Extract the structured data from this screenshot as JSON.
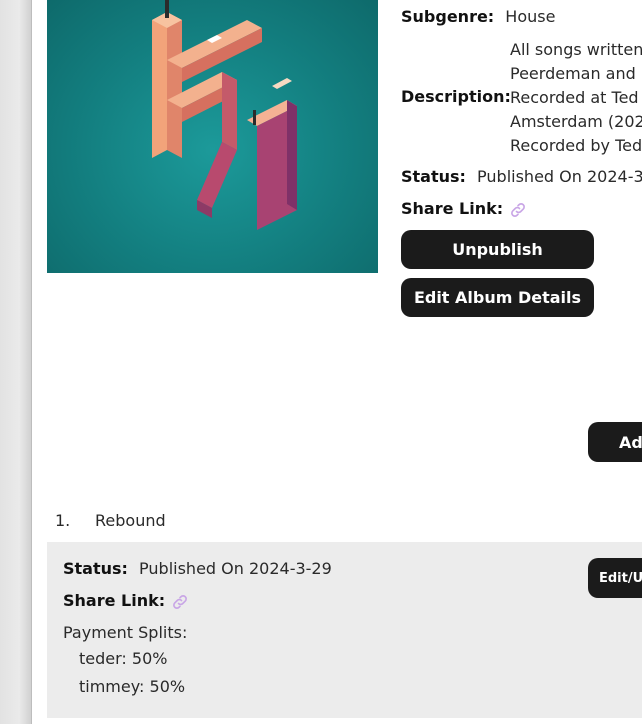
{
  "album": {
    "subgenre_label": "Subgenre:",
    "subgenre": "House",
    "description_label": "Description:",
    "description_lines": [
      "All songs written",
      "Peerdeman and",
      "Recorded at Ted",
      "Amsterdam (202",
      "Recorded by Ted"
    ],
    "status_label": "Status:",
    "status": "Published On 2024-3-",
    "share_link_label": "Share Link:",
    "unpublish_label": "Unpublish",
    "edit_details_label": "Edit Album Details",
    "add_button_label": "Ad"
  },
  "tracks": [
    {
      "number": "1.",
      "title": "Rebound",
      "status_label": "Status:",
      "status": "Published On 2024-3-29",
      "share_link_label": "Share Link:",
      "payment_splits_label": "Payment Splits:",
      "splits": [
        "teder: 50%",
        "timmey: 50%"
      ],
      "edit_button_label": "Edit/U"
    }
  ],
  "colors": {
    "button_bg": "#1b1b1b",
    "link_icon": "#c9a6e6",
    "cover_teal": "#137f80",
    "track_box_bg": "#ececec"
  },
  "icons": {
    "share_link": "link-icon"
  }
}
